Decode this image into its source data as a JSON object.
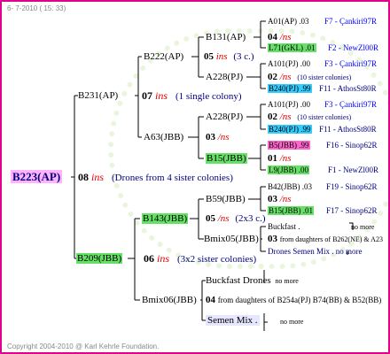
{
  "header": {
    "timestamp": "6- 7-2010 ( 15: 33)"
  },
  "footer": {
    "copyright": "Copyright 2004-2010 @ Karl Kehrle Foundation."
  },
  "root": {
    "label": "B223(AP)",
    "gen": "08",
    "ins": "ins",
    "note": "(Drones from 4 sister colonies)"
  },
  "b231": {
    "label": "B231(AP)",
    "gen": "07",
    "ins": "ins",
    "note": "(1 single colony)"
  },
  "b222": {
    "label": "B222(AP)",
    "gen": "05",
    "ins": "ins",
    "note": "(3 c.)"
  },
  "b131": {
    "label": "B131(AP)",
    "gen": "04",
    "ins": "/ns"
  },
  "a01": {
    "label": "A01(AP) .03",
    "ref": "F7 - Çankiri97R"
  },
  "l71": {
    "label": "L71(GKL) .01",
    "ref": "F2 - NewZl00R"
  },
  "a228a": {
    "label": "A228(PJ)",
    "gen": "02",
    "ins": "/ns",
    "note": "(10 sister colonies)"
  },
  "a101a": {
    "label": "A101(PJ) .00",
    "ref": "F3 - Çankiri97R"
  },
  "b240a": {
    "label": "B240(PJ) .99",
    "ref": "F11 - AthosSt80R"
  },
  "a63": {
    "label": "A63(JBB)",
    "gen": "03",
    "ins": "/ns"
  },
  "a228b": {
    "label": "A228(PJ)",
    "gen": "02",
    "ins": "/ns",
    "note": "(10 sister colonies)"
  },
  "a101b": {
    "label": "A101(PJ) .00",
    "ref": "F3 - Çankiri97R"
  },
  "b240b": {
    "label": "B240(PJ) .99",
    "ref": "F11 - AthosSt80R"
  },
  "b15a": {
    "label": "B15(JBB)",
    "gen": "01",
    "ins": "/ns"
  },
  "b5": {
    "label": "B5(JBB) .99",
    "ref": "F16 - Sinop62R"
  },
  "l9": {
    "label": "L9(JBB) .00",
    "ref": "F1 - NewZl00R"
  },
  "b209": {
    "label": "B209(JBB)",
    "gen": "06",
    "ins": "ins",
    "note": "(3x2 sister colonies)"
  },
  "b143": {
    "label": "B143(JBB)",
    "gen": "05",
    "ins": "/ns",
    "note": "(2x3 c.)"
  },
  "b59": {
    "label": "B59(JBB)",
    "gen": "03",
    "ins": "/ns"
  },
  "b42": {
    "label": "B42(JBB) .03",
    "ref": "F19 - Sinop62R"
  },
  "b15b": {
    "label": "B15(JBB) .01",
    "ref": "F17 - Sinop62R"
  },
  "bmix05": {
    "label": "Bmix05(JBB)"
  },
  "buckfast_a": {
    "label": "Buckfast .",
    "nomore": "no more"
  },
  "g03": {
    "gen": "03",
    "text": "from daughters of B262(NE) & A23"
  },
  "drones_semen": {
    "label": "Drones Semen Mix .",
    "nomore": "no more"
  },
  "bmix06": {
    "label": "Bmix06(JBB)"
  },
  "buckfast_drones": {
    "label": "Buckfast Drones",
    "nomore": "no more"
  },
  "g04": {
    "gen": "04",
    "text": "from daughters of B254a(PJ) B74(BB) & B52(BB)"
  },
  "semen_mix": {
    "label": "Semen Mix .",
    "nomore": "no more"
  }
}
